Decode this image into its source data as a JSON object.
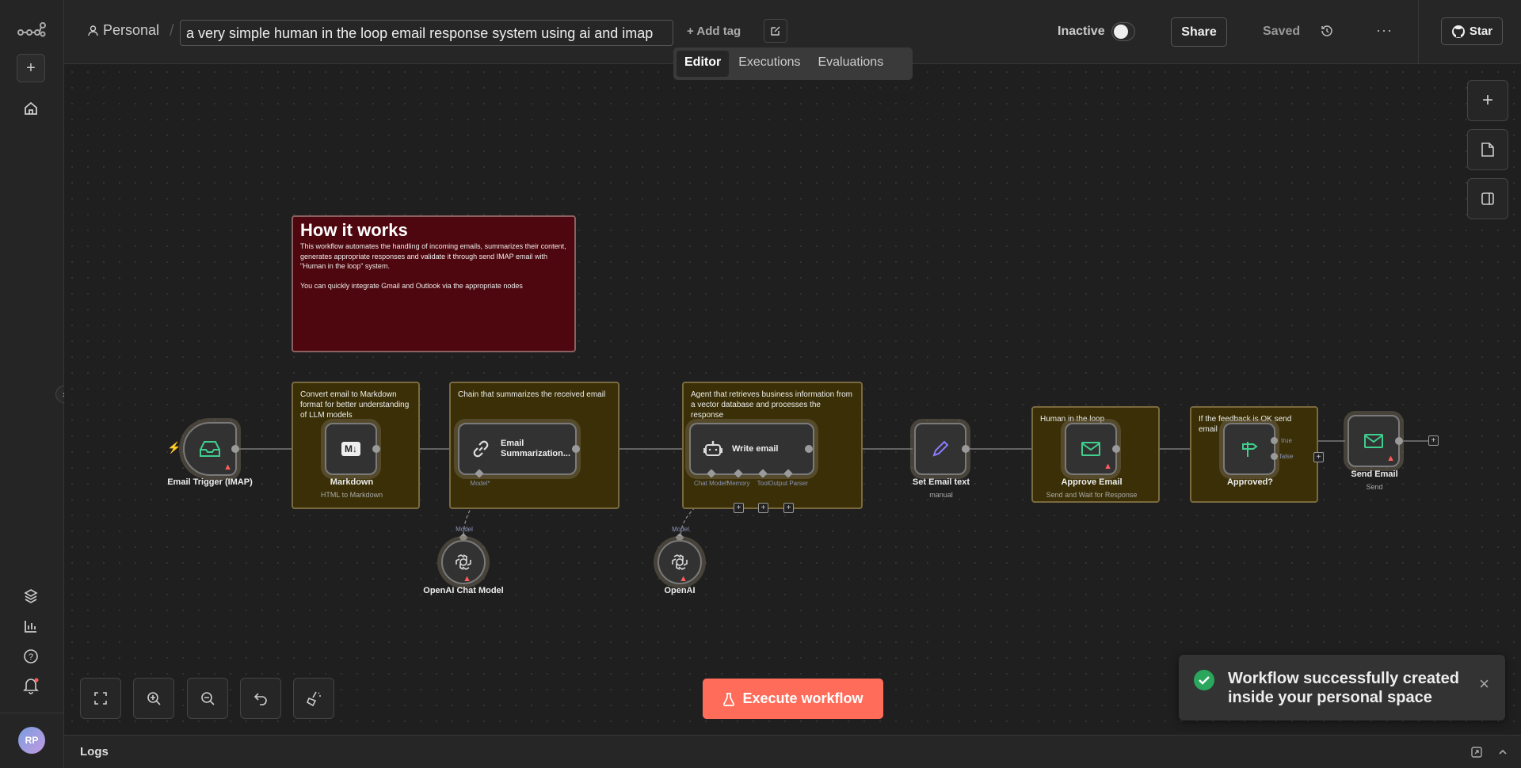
{
  "sidebar": {
    "avatar_initials": "RP"
  },
  "header": {
    "project": "Personal",
    "separator": "/",
    "workflow_name": "a very simple human in the loop email response system using ai and imap",
    "add_tag": "+ Add tag",
    "status": "Inactive",
    "share": "Share",
    "saved": "Saved",
    "star": "Star"
  },
  "tabs": {
    "editor": "Editor",
    "executions": "Executions",
    "evaluations": "Evaluations"
  },
  "notes": {
    "how": {
      "title": "How it works",
      "p1": "This workflow automates the handling of incoming emails, summarizes their content, generates appropriate responses and validate it through send IMAP email with \"Human in the loop\" system.",
      "p2": "You can quickly integrate Gmail and Outlook via the appropriate nodes"
    },
    "markdown": "Convert email to Markdown format for better understanding of LLM models",
    "chain": "Chain that summarizes the received email",
    "agent": "Agent that retrieves business information from a vector database and processes the response",
    "hitl": "Human in the loop",
    "feedback": "If the feedback is OK send email"
  },
  "nodes": {
    "trigger": {
      "label": "Email Trigger (IMAP)"
    },
    "markdown": {
      "label": "Markdown",
      "sub": "HTML to Markdown",
      "icon_text": "M↓"
    },
    "summ": {
      "label": "Email Summarization..."
    },
    "write": {
      "label": "Write email",
      "p_chat": "Chat Model*",
      "p_memory": "Memory",
      "p_tool": "Tool",
      "p_parser": "Output Parser"
    },
    "set": {
      "label": "Set Email text",
      "sub": "manual"
    },
    "approve": {
      "label": "Approve Email",
      "sub": "Send and Wait for Response"
    },
    "ifnode": {
      "label": "Approved?",
      "p_true": "true",
      "p_false": "false"
    },
    "send": {
      "label": "Send Email",
      "sub": "Send"
    },
    "openai_chat": {
      "label": "OpenAI Chat Model",
      "port": "Model"
    },
    "openai": {
      "label": "OpenAI",
      "port": "Model"
    },
    "summ_model_port": "Model*"
  },
  "execute": "Execute workflow",
  "toast": {
    "line1": "Workflow successfully created",
    "line2": "inside your personal space"
  },
  "logs": "Logs"
}
